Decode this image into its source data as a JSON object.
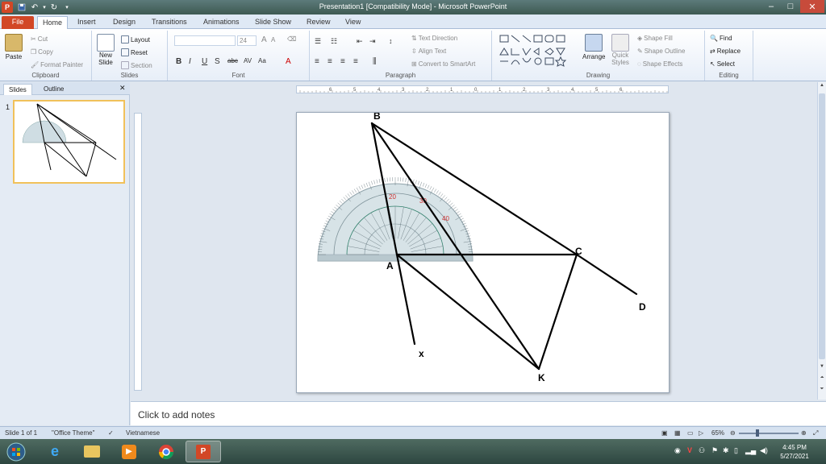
{
  "window": {
    "title": "Presentation1 [Compatibility Mode]  -  Microsoft PowerPoint",
    "app_icon": "P"
  },
  "tabs": [
    "File",
    "Home",
    "Insert",
    "Design",
    "Transitions",
    "Animations",
    "Slide Show",
    "Review",
    "View"
  ],
  "active_tab": "Home",
  "ribbon": {
    "clipboard": {
      "label": "Clipboard",
      "paste": "Paste",
      "cut": "Cut",
      "copy": "Copy",
      "format_painter": "Format Painter"
    },
    "slides": {
      "label": "Slides",
      "new_slide": "New",
      "new_slide_2": "Slide",
      "layout": "Layout",
      "reset": "Reset",
      "section": "Section"
    },
    "font": {
      "label": "Font",
      "size": "24"
    },
    "paragraph": {
      "label": "Paragraph",
      "text_direction": "Text Direction",
      "align_text": "Align Text",
      "convert_smartart": "Convert to SmartArt"
    },
    "drawing": {
      "label": "Drawing",
      "arrange": "Arrange",
      "quick_styles": "Quick",
      "quick_styles_2": "Styles",
      "shape_fill": "Shape Fill",
      "shape_outline": "Shape Outline",
      "shape_effects": "Shape Effects"
    },
    "editing": {
      "label": "Editing",
      "find": "Find",
      "replace": "Replace",
      "select": "Select"
    }
  },
  "left_pane": {
    "tabs": [
      "Slides",
      "Outline"
    ],
    "slide_number": "1"
  },
  "ruler": {
    "h_ticks": [
      "6",
      "5",
      "4",
      "3",
      "2",
      "1",
      "0",
      "1",
      "2",
      "3",
      "4",
      "5",
      "6"
    ]
  },
  "slide": {
    "labels": {
      "B": "B",
      "A": "A",
      "C": "C",
      "D": "D",
      "K": "K",
      "x": "x"
    },
    "protractor_marks": [
      "20",
      "30",
      "40"
    ]
  },
  "notes": {
    "placeholder": "Click to add notes"
  },
  "status": {
    "slide_info": "Slide 1 of 1",
    "theme": "\"Office Theme\"",
    "language": "Vietnamese",
    "zoom": "65%"
  },
  "taskbar": {
    "time": "4:45 PM",
    "date": "5/27/2021"
  }
}
